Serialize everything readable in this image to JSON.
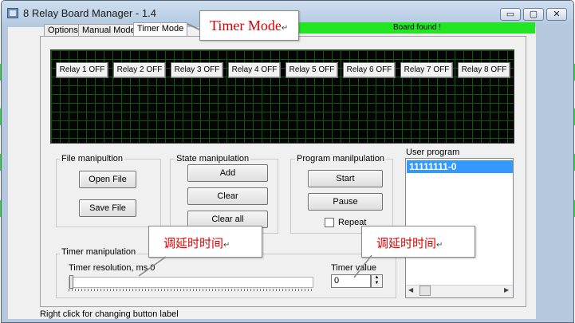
{
  "window": {
    "title": "8 Relay Board Manager  - 1.4",
    "buttons": {
      "minimize": "▭",
      "maximize": "▢",
      "close": "✕"
    }
  },
  "tabs": [
    {
      "label": "Options"
    },
    {
      "label": "Manual Mode"
    },
    {
      "label": "Timer Mode"
    }
  ],
  "status_banner": "Board found !",
  "relays": [
    {
      "label": "Relay 1 OFF"
    },
    {
      "label": "Relay 2 OFF"
    },
    {
      "label": "Relay 3 OFF"
    },
    {
      "label": "Relay 4 OFF"
    },
    {
      "label": "Relay 5 OFF"
    },
    {
      "label": "Relay 6 OFF"
    },
    {
      "label": "Relay 7 OFF"
    },
    {
      "label": "Relay 8 OFF"
    }
  ],
  "file_group": {
    "title": "File manipultion",
    "open": "Open File",
    "save": "Save File"
  },
  "state_group": {
    "title": "State manipulation",
    "add": "Add",
    "clear": "Clear",
    "clear_all": "Clear all"
  },
  "program_group": {
    "title": "Program manilpulation",
    "start": "Start",
    "pause": "Pause",
    "repeat": "Repeat"
  },
  "user_program": {
    "label": "User program",
    "items": [
      "11111111-0"
    ]
  },
  "timer_group": {
    "title": "Timer manipulation",
    "resolution_label": "Timer resolution, ms 0",
    "value_label": "Timer value",
    "value": "0"
  },
  "status_bar": "Right click for changing button label",
  "annotations": {
    "timer_mode": "Timer Mode",
    "delay_1": "调延时时间",
    "delay_2": "调延时时间",
    "para": "↵"
  },
  "colors": {
    "status_green": "#22e622",
    "grid_green": "#0d5a0d",
    "selection_blue": "#3399ff",
    "annotation_red": "#e00000"
  }
}
